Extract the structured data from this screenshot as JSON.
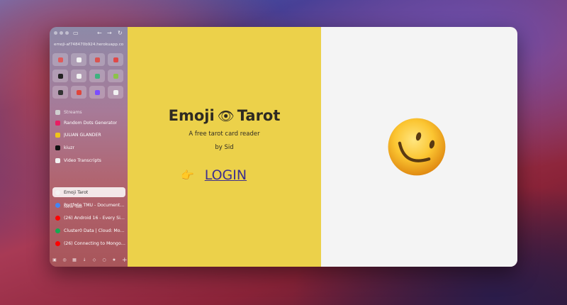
{
  "browser": {
    "url": "emoji-af748470b924.herokuapp.com",
    "favorites": [
      {
        "icon": "red-favicon-icon",
        "color": "#e05a5a"
      },
      {
        "icon": "calendar-favicon-icon",
        "color": "#f2f2f2"
      },
      {
        "icon": "red-favicon-icon",
        "color": "#d9534f"
      },
      {
        "icon": "red-favicon-icon",
        "color": "#e04848"
      },
      {
        "icon": "notion-favicon-icon",
        "color": "#222222"
      },
      {
        "icon": "notion-favicon-icon",
        "color": "#f2f2f2"
      },
      {
        "icon": "green-favicon-icon",
        "color": "#3fb27f"
      },
      {
        "icon": "multicolor-favicon-icon",
        "color": "#8bc34a"
      },
      {
        "icon": "github-favicon-icon",
        "color": "#333333"
      },
      {
        "icon": "red-favicon-icon",
        "color": "#e0453b"
      },
      {
        "icon": "purple-favicon-icon",
        "color": "#7c4dff"
      },
      {
        "icon": "blue-favicon-icon",
        "color": "#f2f2f2"
      }
    ],
    "sidebar_items": [
      {
        "label": "Streams",
        "icon": "video-icon",
        "color": "#cfcfcf"
      },
      {
        "label": "Random Dots Generator",
        "icon": "dots-favicon-icon",
        "color": "#e91e63"
      },
      {
        "label": "JULIAN GLANDER",
        "icon": "julian-favicon-icon",
        "color": "#f0c419"
      },
      {
        "label": "kiuzr",
        "icon": "tiktok-icon",
        "color": "#111111"
      },
      {
        "label": "Video Transcripts",
        "icon": "document-icon",
        "color": "#f2f2f2"
      }
    ],
    "new_tab_label": "New Tab",
    "tabs": [
      {
        "label": "Emoji Tarot",
        "icon": "emoji-tarot-favicon-icon",
        "color": "#f3f3f3",
        "active": true
      },
      {
        "label": "Portfolio TMU - Document (...",
        "icon": "google-docs-icon",
        "color": "#4285f4",
        "active": false
      },
      {
        "label": "(26) Android 16 - Every Sin...",
        "icon": "youtube-icon",
        "color": "#ff0000",
        "active": false
      },
      {
        "label": "Cluster0 Data | Cloud: Mon...",
        "icon": "mongodb-icon",
        "color": "#13aa52",
        "active": false
      },
      {
        "label": "(26) Connecting to MongoD...",
        "icon": "youtube-icon",
        "color": "#ff0000",
        "active": false
      }
    ]
  },
  "page": {
    "title_left": "Emoji",
    "title_emoji": "👁",
    "title_right": "Tarot",
    "subtitle": "A free tarot card reader",
    "byline": "by Sid",
    "pointer_emoji": "👉",
    "login_label": "LOGIN",
    "left_bg": "#ecd14a",
    "right_bg": "#f4f4f4",
    "card_emoji": "smiling-face-emoji"
  }
}
